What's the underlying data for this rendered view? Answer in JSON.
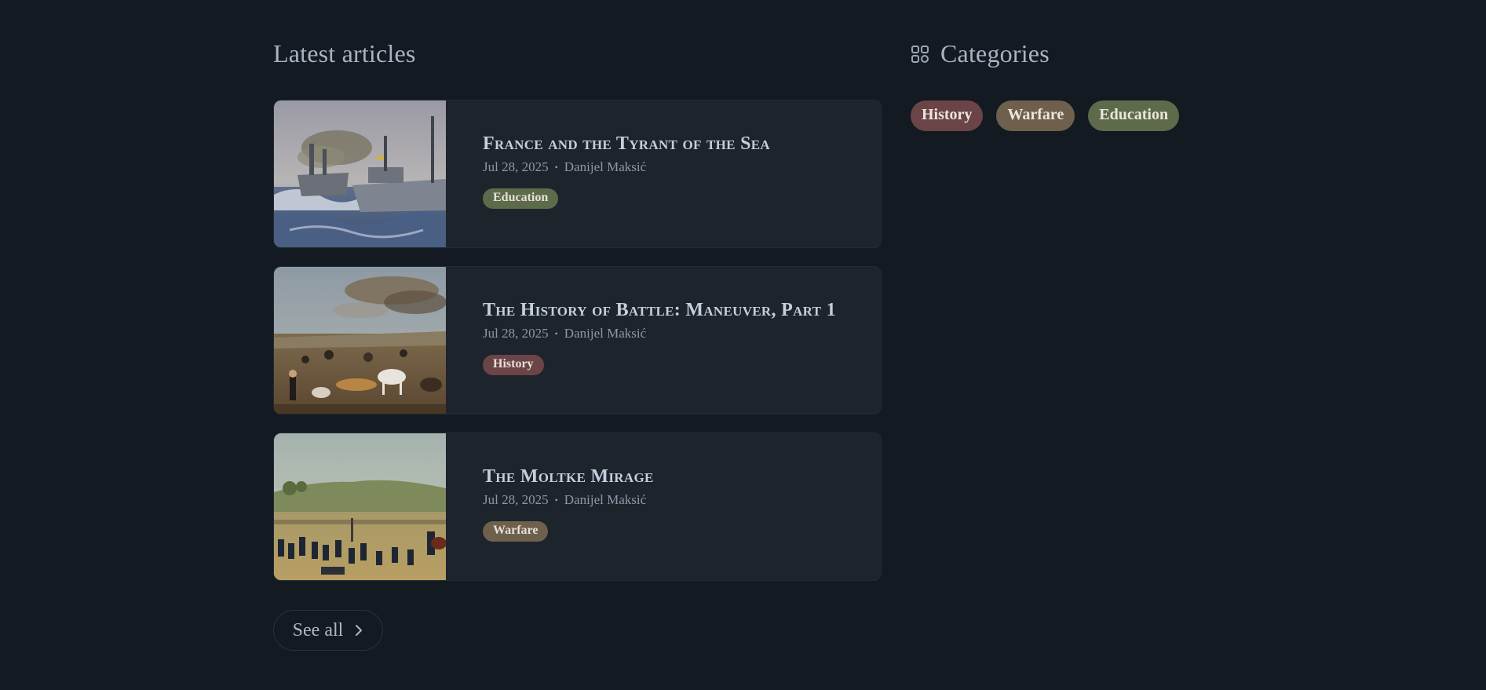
{
  "latest": {
    "title": "Latest articles",
    "see_all_label": "See all",
    "articles": [
      {
        "title": "France and the Tyrant of the Sea",
        "date": "Jul 28, 2025",
        "author": "Danijel Maksić",
        "tag": "Education",
        "tag_color": "#5e6b4a",
        "image": "naval-battle-painting"
      },
      {
        "title": "The History of Battle: Maneuver, Part 1",
        "date": "Jul 28, 2025",
        "author": "Danijel Maksić",
        "tag": "History",
        "tag_color": "#6b4448",
        "image": "cavalry-battle-painting"
      },
      {
        "title": "The Moltke Mirage",
        "date": "Jul 28, 2025",
        "author": "Danijel Maksić",
        "tag": "Warfare",
        "tag_color": "#6e604c",
        "image": "infantry-battle-painting"
      }
    ]
  },
  "categories": {
    "title": "Categories",
    "icon": "grid-icon",
    "items": [
      {
        "label": "History",
        "color": "#6b4448"
      },
      {
        "label": "Warfare",
        "color": "#6e604c"
      },
      {
        "label": "Education",
        "color": "#5e6b4a"
      }
    ]
  },
  "colors": {
    "background": "#141a22",
    "card": "#1e242c",
    "text": "#aab5c2"
  }
}
